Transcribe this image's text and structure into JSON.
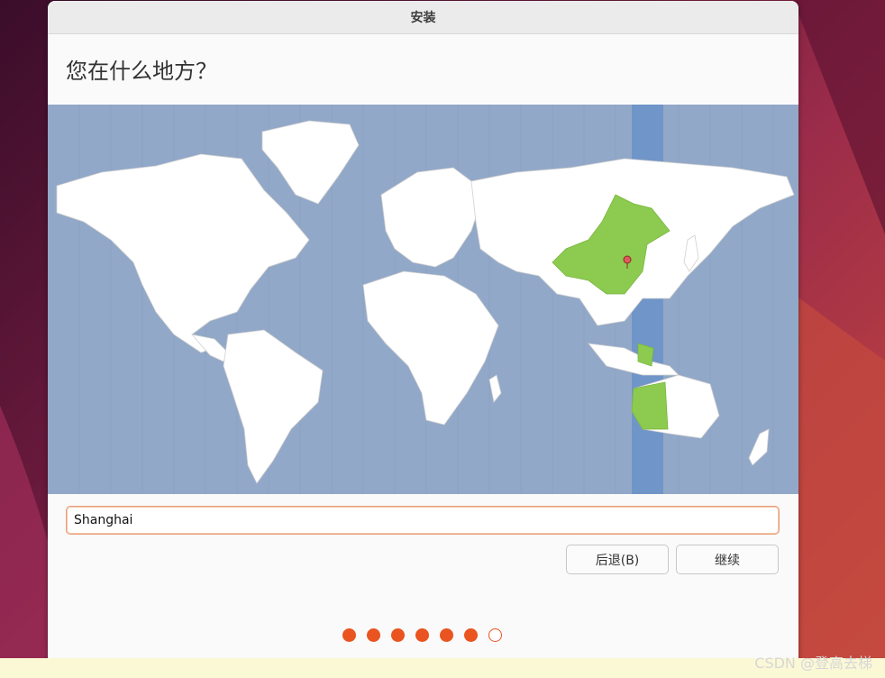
{
  "window": {
    "title": "安装"
  },
  "page": {
    "heading": "您在什么地方？"
  },
  "timezone": {
    "input_value": "Shanghai",
    "highlight_color": "#8ccb4f",
    "band_color": "#7095c8",
    "marker_color": "#e05a5a"
  },
  "buttons": {
    "back_label": "后退(B)",
    "continue_label": "继续"
  },
  "progress": {
    "total_steps": 7,
    "completed_steps": 6,
    "accent": "#e95420"
  },
  "watermark": {
    "text": "CSDN @登高去梯"
  }
}
